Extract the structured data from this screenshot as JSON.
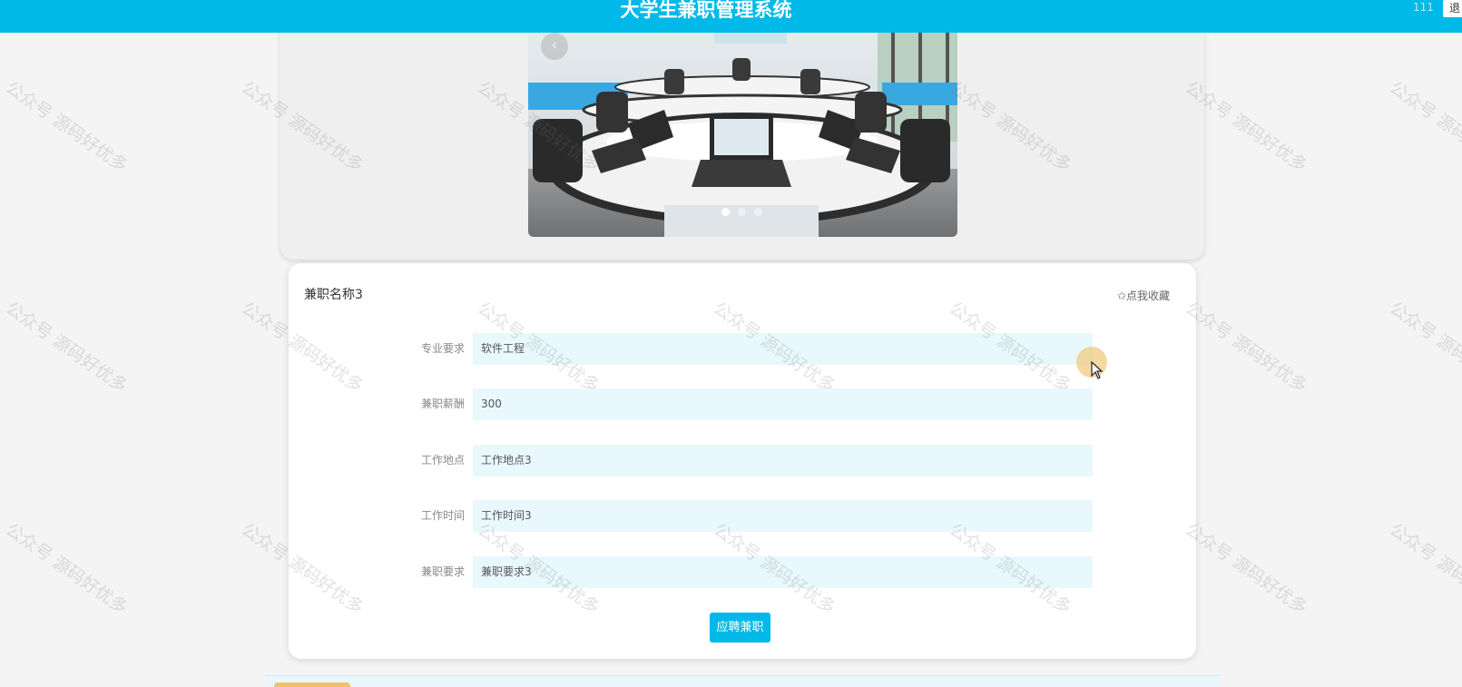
{
  "header": {
    "site_title": "大学生兼职管理系统",
    "username": "111",
    "logout_label": "退"
  },
  "carousel": {
    "prev_glyph": "‹",
    "slide_count": 3,
    "active_slide": 1
  },
  "detail": {
    "job_title": "兼职名称3",
    "favorite_label": "✩点我收藏",
    "fields": [
      {
        "label": "专业要求",
        "value": "软件工程"
      },
      {
        "label": "兼职薪酬",
        "value": "300"
      },
      {
        "label": "工作地点",
        "value": "工作地点3"
      },
      {
        "label": "工作时间",
        "value": "工作时间3"
      },
      {
        "label": "兼职要求",
        "value": "兼职要求3"
      }
    ],
    "apply_label": "应聘兼职"
  },
  "watermark": {
    "text": "公众号 源码好优多"
  },
  "colors": {
    "header": "#00b9e8",
    "field_bg": "#e8f8fd",
    "button": "#00b9e8",
    "page_bg": "#f4f4f4"
  }
}
